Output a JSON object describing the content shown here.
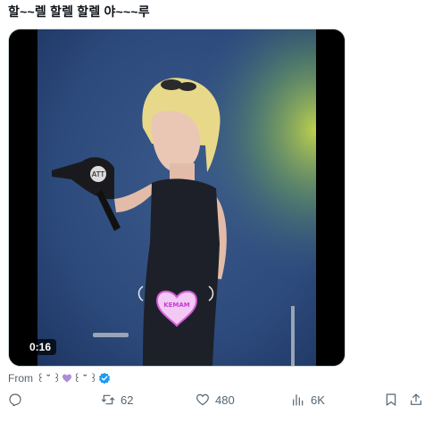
{
  "post": {
    "text": "할~~렐 할렐 할렐 야~~~루"
  },
  "media": {
    "duration": "0:16"
  },
  "source": {
    "prefix": "From",
    "name_left": "꒰ ˘ ꒱",
    "name_right": "꒰ ˘ ꒱"
  },
  "actions": {
    "reposts": "62",
    "likes": "480",
    "views": "6K"
  },
  "colors": {
    "text": "#0f1419",
    "muted": "#536471",
    "verified": "#1d9bf0",
    "border": "#cfd9de"
  }
}
